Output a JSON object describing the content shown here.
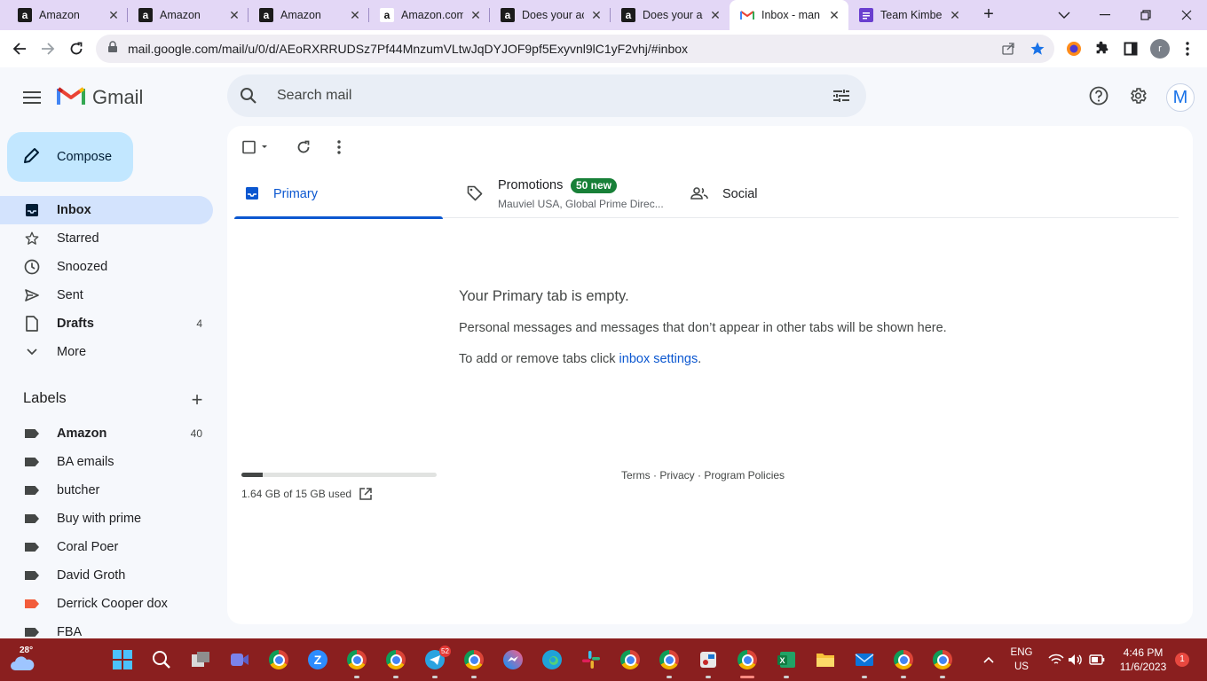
{
  "browser": {
    "tabs": [
      {
        "title": "Amazon",
        "favicon": "amazon-icon",
        "active": false
      },
      {
        "title": "Amazon",
        "favicon": "amazon-icon",
        "active": false
      },
      {
        "title": "Amazon",
        "favicon": "amazon-icon",
        "active": false
      },
      {
        "title": "Amazon.com",
        "favicon": "amazon-icon",
        "active": false
      },
      {
        "title": "Does your ac",
        "favicon": "amazon-icon",
        "active": false
      },
      {
        "title": "Does your ac",
        "favicon": "amazon-icon",
        "active": false
      },
      {
        "title": "Inbox - man",
        "favicon": "gmail-icon",
        "active": true
      },
      {
        "title": "Team Kimbe",
        "favicon": "forms-icon",
        "active": false
      }
    ],
    "url": "mail.google.com/mail/u/0/d/AEoRXRRUDSz7Pf44MnzumVLtwJqDYJOF9pf5Exyvnl9lC1yF2vhj/#inbox",
    "profile_initial": "r"
  },
  "gmail": {
    "brand": "Gmail",
    "search_placeholder": "Search mail",
    "avatar_initial": "M",
    "compose_label": "Compose",
    "nav": [
      {
        "label": "Inbox",
        "icon": "inbox-icon",
        "count": "",
        "active": true
      },
      {
        "label": "Starred",
        "icon": "star-icon",
        "count": "",
        "active": false
      },
      {
        "label": "Snoozed",
        "icon": "clock-icon",
        "count": "",
        "active": false
      },
      {
        "label": "Sent",
        "icon": "send-icon",
        "count": "",
        "active": false
      },
      {
        "label": "Drafts",
        "icon": "draft-icon",
        "count": "4",
        "active": false
      },
      {
        "label": "More",
        "icon": "chevron-down-icon",
        "count": "",
        "active": false
      }
    ],
    "labels_title": "Labels",
    "labels": [
      {
        "name": "Amazon",
        "count": "40",
        "color": "#444746"
      },
      {
        "name": "BA emails",
        "count": "",
        "color": "#444746"
      },
      {
        "name": "butcher",
        "count": "",
        "color": "#444746"
      },
      {
        "name": "Buy with prime",
        "count": "",
        "color": "#444746"
      },
      {
        "name": "Coral Poer",
        "count": "",
        "color": "#444746"
      },
      {
        "name": "David Groth",
        "count": "",
        "color": "#444746"
      },
      {
        "name": "Derrick Cooper dox",
        "count": "",
        "color": "#f25c3b"
      },
      {
        "name": "FBA",
        "count": "",
        "color": "#444746"
      }
    ],
    "inbox_tabs": {
      "primary": "Primary",
      "promotions": "Promotions",
      "promotions_badge": "50 new",
      "promotions_senders": "Mauviel USA, Global Prime Direc...",
      "social": "Social"
    },
    "empty_title": "Your Primary tab is empty.",
    "empty_body": "Personal messages and messages that don’t appear in other tabs will be shown here.",
    "empty_tabs_prefix": "To add or remove tabs click ",
    "empty_tabs_link": "inbox settings",
    "empty_tabs_suffix": ".",
    "storage_used_text": "1.64 GB of 15 GB used",
    "storage_fraction": 0.109,
    "footer": "Terms · Privacy · Program Policies"
  },
  "taskbar": {
    "temperature": "28°",
    "lang_line1": "ENG",
    "lang_line2": "US",
    "time": "4:46 PM",
    "date": "11/6/2023",
    "notifications": "1",
    "telegram_badge": "52"
  },
  "colors": {
    "accent": "#0b57d0",
    "compose_bg": "#c2e7ff",
    "taskbar": "#8a1f1f",
    "tabstrip": "#e3d7f6",
    "promo_badge": "#188038"
  }
}
